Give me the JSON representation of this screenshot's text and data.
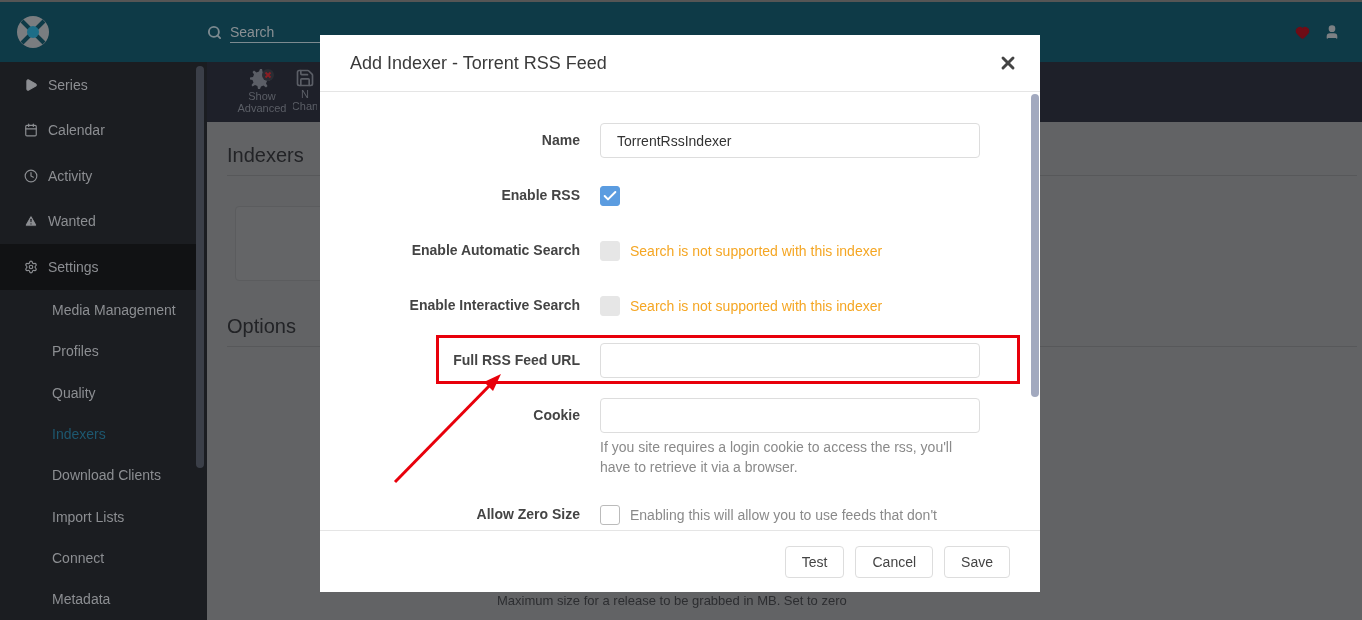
{
  "header": {
    "search": {
      "placeholder": "Search"
    }
  },
  "sidebar": {
    "items": [
      {
        "kind": "series",
        "label": "Series",
        "selected": false
      },
      {
        "kind": "calendar",
        "label": "Calendar",
        "selected": false
      },
      {
        "kind": "activity",
        "label": "Activity",
        "selected": false
      },
      {
        "kind": "wanted",
        "label": "Wanted",
        "selected": false
      },
      {
        "kind": "settings",
        "label": "Settings",
        "selected": true,
        "children": [
          {
            "label": "Media Management",
            "selected": false
          },
          {
            "label": "Profiles",
            "selected": false
          },
          {
            "label": "Quality",
            "selected": false
          },
          {
            "label": "Indexers",
            "selected": true
          },
          {
            "label": "Download Clients",
            "selected": false
          },
          {
            "label": "Import Lists",
            "selected": false
          },
          {
            "label": "Connect",
            "selected": false
          },
          {
            "label": "Metadata",
            "selected": false
          }
        ]
      }
    ]
  },
  "toolbar": [
    {
      "kind": "advanced",
      "label": "Show Advanced"
    },
    {
      "kind": "save",
      "label": "N Chan"
    }
  ],
  "page": {
    "sections": [
      "Indexers",
      "Options"
    ],
    "size_help": "Maximum size for a release to be grabbed in MB. Set to zero"
  },
  "modal": {
    "title": "Add Indexer - Torrent RSS Feed",
    "fields": [
      {
        "kind": "text",
        "label": "Name",
        "value": "TorrentRssIndexer"
      },
      {
        "kind": "checkbox",
        "label": "Enable RSS",
        "checked": true,
        "disabled": false
      },
      {
        "kind": "checkbox",
        "label": "Enable Automatic Search",
        "checked": false,
        "disabled": true,
        "warning": "Search is not supported with this indexer"
      },
      {
        "kind": "checkbox",
        "label": "Enable Interactive Search",
        "checked": false,
        "disabled": true,
        "warning": "Search is not supported with this indexer"
      },
      {
        "kind": "text",
        "label": "Full RSS Feed URL",
        "highlighted": true
      },
      {
        "kind": "text",
        "label": "Cookie",
        "help": "If you site requires a login cookie to access the rss, you'll have to retrieve it via a browser."
      },
      {
        "kind": "checkbox",
        "label": "Allow Zero Size",
        "checked": false,
        "disabled": false,
        "help": "Enabling this will allow you to use feeds that don't"
      }
    ],
    "buttons": [
      "Test",
      "Cancel",
      "Save"
    ]
  }
}
